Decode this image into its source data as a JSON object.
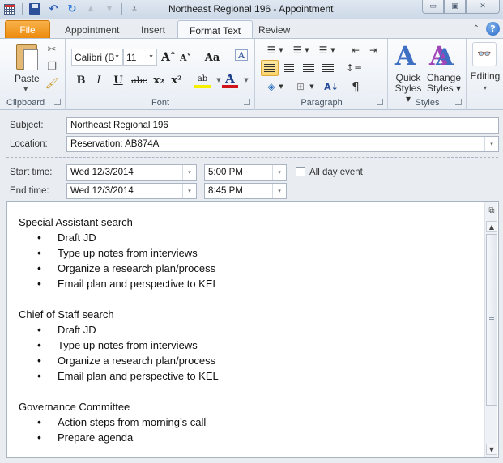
{
  "window": {
    "title": "Northeast Regional 196  -  Appointment",
    "controls": {
      "minimize": "▭",
      "maximize": "▣",
      "close": "✕"
    }
  },
  "qat": {
    "icons": [
      "calendar-icon",
      "save-icon",
      "undo-icon",
      "redo-icon",
      "arrow-up-icon",
      "arrow-down-icon",
      "customize-icon"
    ],
    "undo_glyph": "↶",
    "redo_glyph": "↻",
    "up_glyph": "▲",
    "down_glyph": "▼",
    "customize_glyph": "⩡"
  },
  "tabs": [
    {
      "label": "File"
    },
    {
      "label": "Appointment"
    },
    {
      "label": "Insert"
    },
    {
      "label": "Format Text",
      "active": true
    },
    {
      "label": "Review"
    }
  ],
  "help": {
    "glyph": "?",
    "collapse_glyph": "⌃"
  },
  "ribbon": {
    "clipboard": {
      "label": "Clipboard",
      "paste_label": "Paste",
      "cut_glyph": "✂",
      "copy_glyph": "❐",
      "painter_glyph": "🖌"
    },
    "font": {
      "label": "Font",
      "font_name": "Calibri (B",
      "font_size": "11",
      "grow_glyph": "A˄",
      "shrink_glyph": "A˅",
      "case_glyph": "Aa",
      "clear_glyph": "A",
      "bold": "B",
      "italic": "I",
      "underline": "U",
      "strikethrough": "abc",
      "subscript": "x₂",
      "superscript": "x²",
      "highlight_glyph": "ab",
      "highlight_color": "#f5f000",
      "font_color_glyph": "A",
      "font_color": "#d0161b"
    },
    "paragraph": {
      "label": "Paragraph",
      "bullets_glyph": "☰",
      "numbering_glyph": "☰",
      "multilevel_glyph": "☰",
      "decrease_indent_glyph": "⇤",
      "increase_indent_glyph": "⇥",
      "line_spacing_glyph": "↕≡",
      "shading_glyph": "◈",
      "borders_glyph": "⊞",
      "sort_glyph": "A↓",
      "pilcrow": "¶"
    },
    "styles": {
      "label": "Styles",
      "quick_styles": "Quick Styles",
      "quick_line1": "Quick",
      "quick_line2": "Styles ▾",
      "change_line1": "Change",
      "change_line2": "Styles ▾",
      "quick_color": "#3f6fc2",
      "change_color": "#a046b8"
    },
    "editing": {
      "label": "Editing",
      "glyph": "👓",
      "arrow": "▾"
    }
  },
  "form": {
    "subject_label": "Subject:",
    "subject_value": "Northeast Regional 196",
    "location_label": "Location:",
    "location_value": "Reservation: AB874A",
    "start_label": "Start time:",
    "start_date": "Wed 12/3/2014",
    "start_time": "5:00 PM",
    "end_label": "End time:",
    "end_date": "Wed 12/3/2014",
    "end_time": "8:45 PM",
    "all_day_label": "All day event",
    "all_day_checked": false,
    "dropdown_glyph": "▾"
  },
  "body": {
    "sections": [
      {
        "title": "Special Assistant search",
        "items": [
          "Draft JD",
          "Type up notes from interviews",
          "Organize a research plan/process",
          "Email plan and perspective to KEL"
        ]
      },
      {
        "title": "Chief of Staff search",
        "items": [
          "Draft JD",
          "Type up notes from interviews",
          "Organize a research plan/process",
          "Email plan and perspective to KEL"
        ]
      },
      {
        "title": "Governance Committee",
        "items": [
          "Action steps from morning’s call",
          "Prepare agenda"
        ]
      }
    ],
    "scroll_up_glyph": "▲",
    "scroll_down_glyph": "▼",
    "split_glyph": "⧉"
  }
}
